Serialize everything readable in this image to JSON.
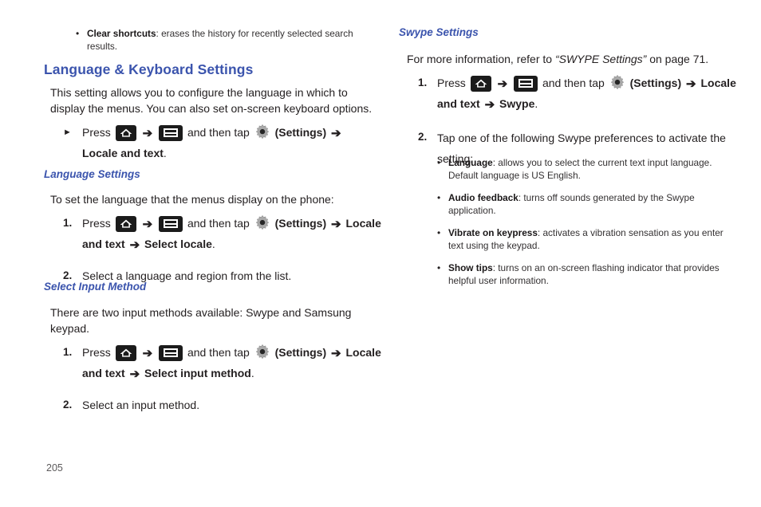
{
  "page": {
    "number": "205"
  },
  "colors": {
    "heading_blue": "#3b54ad",
    "body_black": "#231f20",
    "page_number_gray": "#5c5a5b",
    "icon_black": "#1b1b1b",
    "gear_gray": "#a9a9a9"
  },
  "icons": {
    "home": "home-key-icon",
    "menu": "menu-key-icon",
    "gear": "settings-gear-icon",
    "arrow": "➔",
    "triangle_bullet": "►",
    "round_bullet": "•"
  },
  "left_column": {
    "top_bullets": [
      {
        "term": "Clear shortcuts",
        "text": ": erases the history for recently selected search results."
      }
    ],
    "section_title": "Language & Keyboard Settings",
    "intro": "This setting allows you to configure the language in which to display the menus. You can also set on-screen keyboard options.",
    "triangle_step": {
      "press_label": "Press",
      "and_then_tap": "and then tap",
      "settings_label": "(Settings)",
      "tail_bold": "Locale and text",
      "tail_period": "."
    },
    "language_settings": {
      "title": "Language Settings",
      "intro": "To set the language that the menus display on the phone:",
      "steps": [
        {
          "num": "1.",
          "press_label": "Press",
          "and_then_tap": "and then tap",
          "settings_label": "(Settings)",
          "tail_bold_a": "Locale and text",
          "tail_bold_b": "Select locale",
          "tail_period": "."
        },
        {
          "num": "2.",
          "text": "Select a language and region from the list."
        }
      ]
    },
    "select_input_method": {
      "title": "Select Input Method",
      "intro": "There are two input methods available: Swype and Samsung keypad.",
      "steps": [
        {
          "num": "1.",
          "press_label": "Press",
          "and_then_tap": "and then tap",
          "settings_label": "(Settings)",
          "tail_bold_a": "Locale and text",
          "tail_bold_b": "Select input method",
          "tail_period": "."
        },
        {
          "num": "2.",
          "text": "Select an input method."
        }
      ]
    }
  },
  "right_column": {
    "swype_settings": {
      "title": "Swype Settings",
      "reference_prefix": "For more information, refer to",
      "reference_italic": "“SWYPE Settings”",
      "reference_suffix": "on page 71.",
      "steps": [
        {
          "num": "1.",
          "press_label": "Press",
          "and_then_tap": "and then tap",
          "settings_label": "(Settings)",
          "tail_bold_a": "Locale and text",
          "tail_bold_b": "Swype",
          "tail_period": "."
        },
        {
          "num": "2.",
          "text": "Tap one of the following Swype preferences to activate the setting:"
        }
      ],
      "preferences": [
        {
          "term": "Language",
          "text": ": allows you to select the current text input language. Default language is US English."
        },
        {
          "term": "Audio feedback",
          "text": ": turns off sounds generated by the Swype application."
        },
        {
          "term": "Vibrate on keypress",
          "text": ": activates a vibration sensation as you enter text using the keypad."
        },
        {
          "term": "Show tips",
          "text": ": turns on an on-screen flashing indicator that provides helpful user information."
        }
      ]
    }
  }
}
